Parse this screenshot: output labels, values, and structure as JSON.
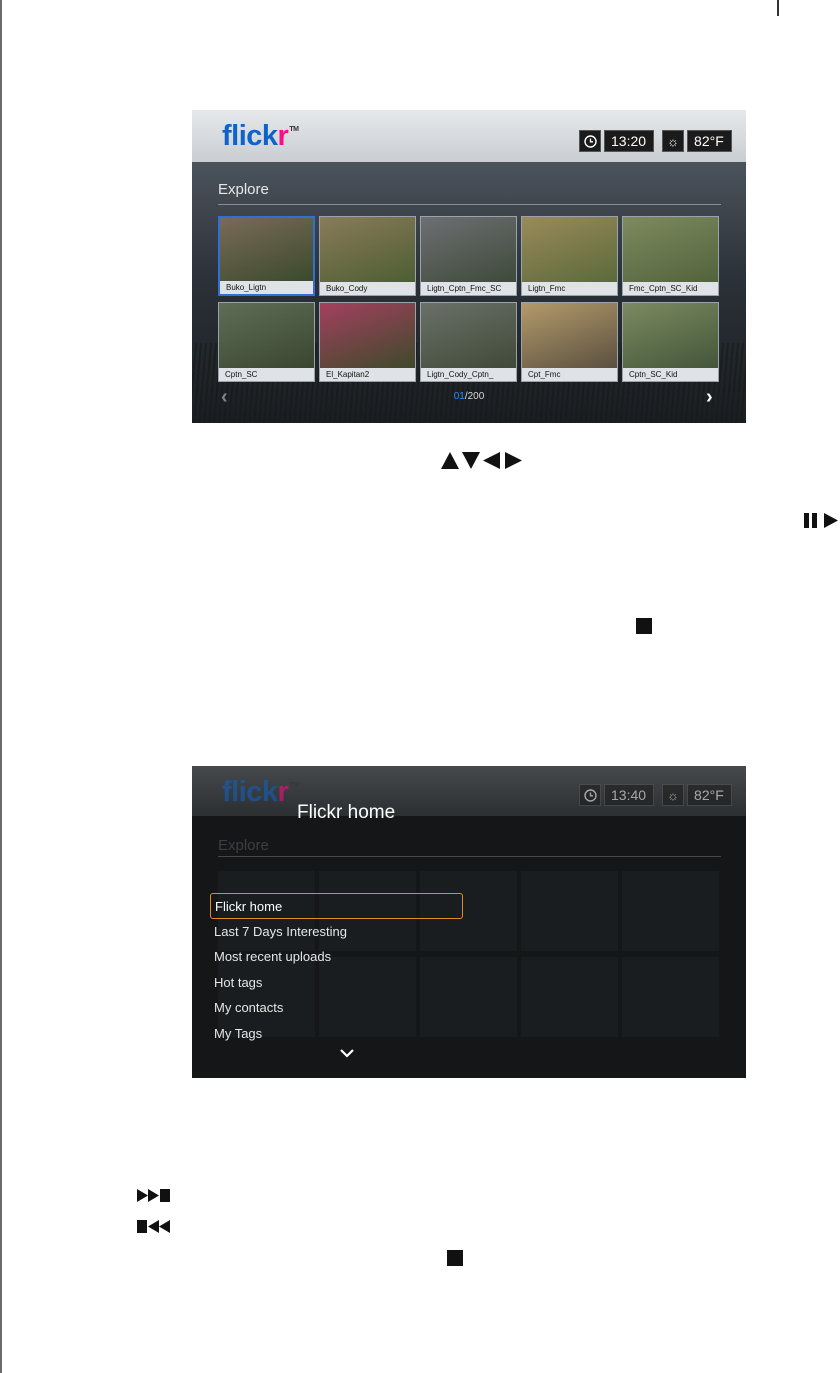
{
  "screen1": {
    "logo": {
      "part1": "flick",
      "part2": "r",
      "tm": "TM"
    },
    "time": "13:20",
    "temperature": "82°F",
    "section": "Explore",
    "tiles": [
      {
        "caption": "Buko_Ligtn",
        "selected": true
      },
      {
        "caption": "Buko_Cody",
        "selected": false
      },
      {
        "caption": "Ligtn_Cptn_Fmc_SC",
        "selected": false
      },
      {
        "caption": "Ligtn_Fmc",
        "selected": false
      },
      {
        "caption": "Fmc_Cptn_SC_Kid",
        "selected": false
      },
      {
        "caption": "Cptn_SC",
        "selected": false
      },
      {
        "caption": "El_Kapitan2",
        "selected": false
      },
      {
        "caption": "Ligtn_Cody_Cptn_",
        "selected": false
      },
      {
        "caption": "Cpt_Fmc",
        "selected": false
      },
      {
        "caption": "Cptn_SC_Kid",
        "selected": false
      }
    ],
    "pager": {
      "current": "01",
      "total": "/200"
    }
  },
  "screen2": {
    "logo": {
      "part1": "flick",
      "part2": "r",
      "tm": "TM"
    },
    "time": "13:40",
    "temperature": "82°F",
    "section": "Explore",
    "overlay_title": "Flickr home",
    "menu": [
      {
        "label": "Flickr home",
        "selected": true
      },
      {
        "label": "Last 7 Days Interesting",
        "selected": false
      },
      {
        "label": "Most recent uploads",
        "selected": false
      },
      {
        "label": "Hot tags",
        "selected": false
      },
      {
        "label": "My contacts",
        "selected": false
      },
      {
        "label": "My Tags",
        "selected": false
      }
    ]
  },
  "icons": {
    "nav_arrows": "up-down-left-right-arrows-icon",
    "pause_play": "pause-play-icon",
    "stop": "stop-icon",
    "next": "next-track-icon",
    "previous": "previous-track-icon"
  }
}
